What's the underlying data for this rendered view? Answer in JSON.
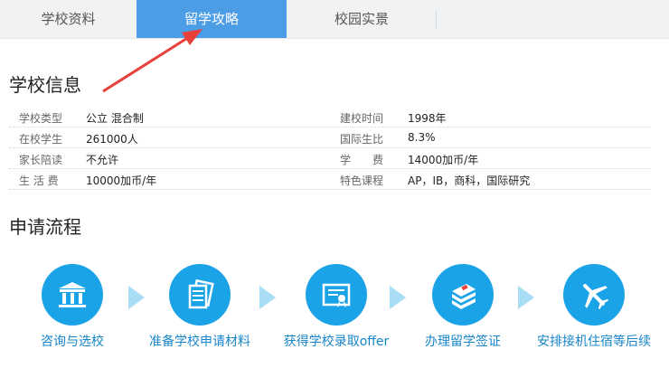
{
  "tabs": [
    {
      "label": "学校资料",
      "active": false
    },
    {
      "label": "留学攻略",
      "active": true
    },
    {
      "label": "校园实景",
      "active": false
    }
  ],
  "colors": {
    "accent": "#4d9ce6",
    "step_circle": "#1ba3e7",
    "step_label": "#1785c8",
    "arrow": "#e8403a"
  },
  "school_info": {
    "title": "学校信息",
    "rows": [
      {
        "left_label": "学校类型",
        "left_value": "公立 混合制",
        "right_label": "建校时间",
        "right_value": "1998年"
      },
      {
        "left_label": "在校学生",
        "left_value": "261000人",
        "right_label": "国际生比",
        "right_value": "8.3%"
      },
      {
        "left_label": "家长陪读",
        "left_value": "不允许",
        "right_label": "学　　费",
        "right_value": "14000加币/年"
      },
      {
        "left_label": "生 活 费",
        "left_value": "10000加币/年",
        "right_label": "特色课程",
        "right_value": "AP，IB，商科，国际研究"
      }
    ]
  },
  "process": {
    "title": "申请流程",
    "steps": [
      {
        "label": "咨询与选校",
        "icon": "school-building-icon"
      },
      {
        "label": "准备学校申请材料",
        "icon": "documents-icon"
      },
      {
        "label": "获得学校录取offer",
        "icon": "certificate-icon"
      },
      {
        "label": "办理留学签证",
        "icon": "passport-icon"
      },
      {
        "label": "安排接机住宿等后续",
        "icon": "airplane-icon"
      }
    ]
  }
}
